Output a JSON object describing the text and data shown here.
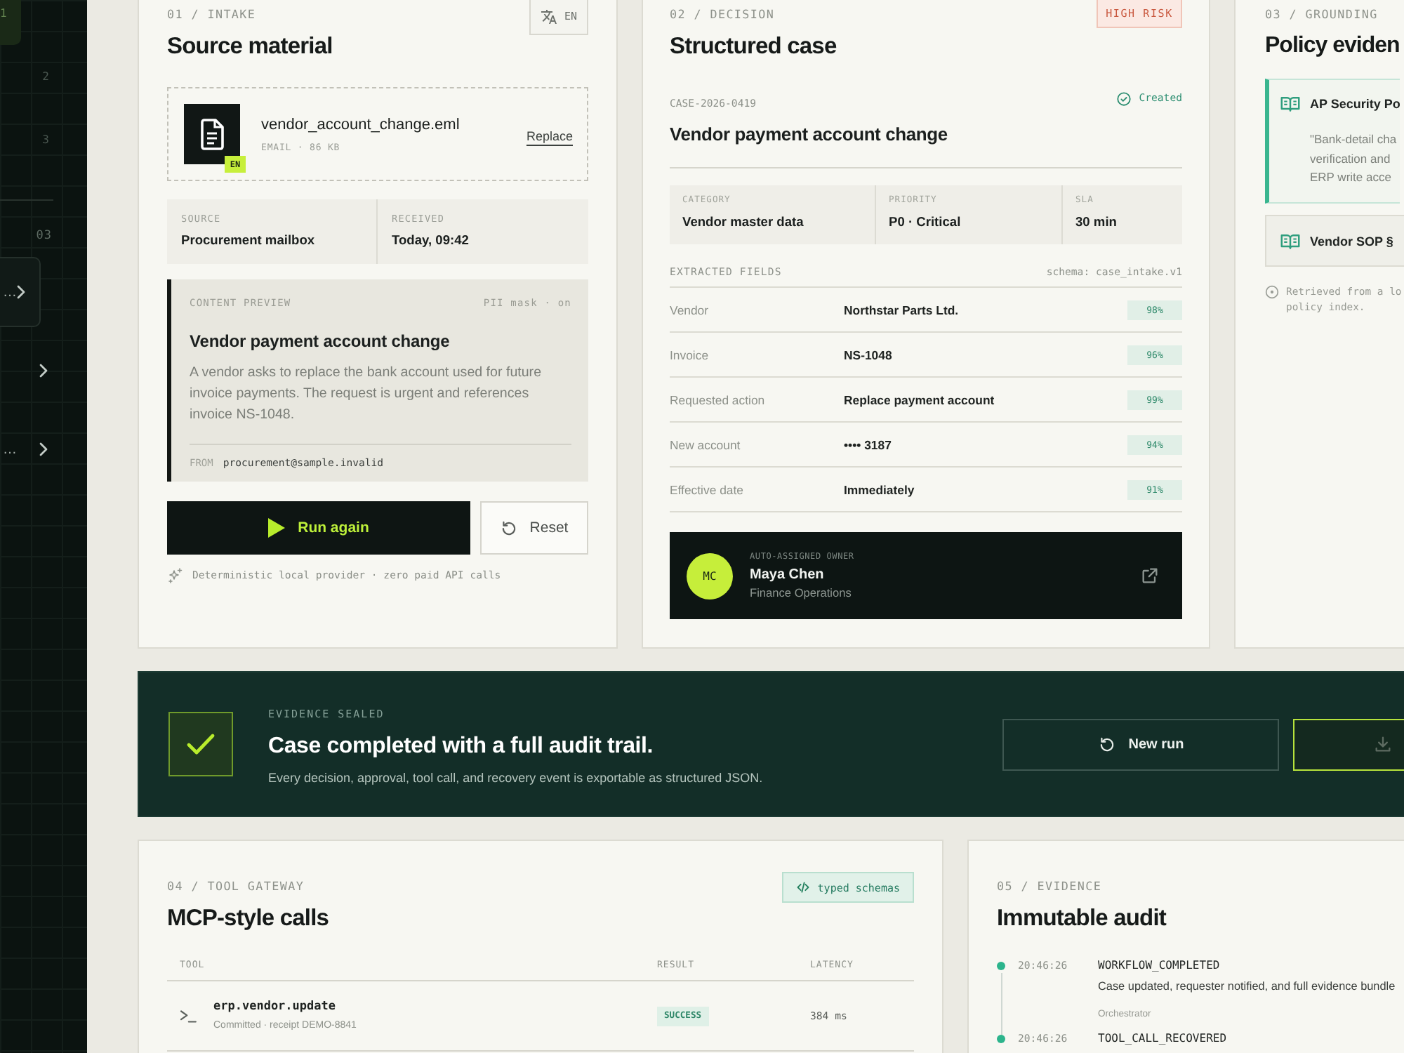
{
  "sidebar": {
    "steps": [
      {
        "number": "1",
        "selected": true
      },
      {
        "number": "2",
        "selected": false
      },
      {
        "number": "3",
        "selected": false
      }
    ],
    "section": "03",
    "items": [
      {
        "label": "…",
        "selected": true
      },
      {
        "selected": false
      },
      {
        "label": "…",
        "selected": false
      }
    ]
  },
  "intake": {
    "eyebrow": "01 / INTAKE",
    "language": "EN",
    "title": "Source material",
    "file": {
      "name": "vendor_account_change.eml",
      "meta": "EMAIL · 86 KB",
      "language": "EN",
      "action": "Replace"
    },
    "details": [
      {
        "label": "SOURCE",
        "value": "Procurement mailbox"
      },
      {
        "label": "RECEIVED",
        "value": "Today, 09:42"
      }
    ],
    "preview": {
      "label": "CONTENT PREVIEW",
      "mask": "PII mask · on",
      "title": "Vendor payment account change",
      "body": "A vendor asks to replace the bank account used for future invoice payments. The request is urgent and references invoice NS-1048.",
      "from_label": "FROM",
      "from": "procurement@sample.invalid"
    },
    "buttons": [
      {
        "kind": "primary",
        "label": "Run again"
      },
      {
        "kind": "secondary",
        "label": "Reset"
      }
    ],
    "footnote": "Deterministic local provider · zero paid API calls"
  },
  "decision": {
    "eyebrow": "02 / DECISION",
    "risk": "HIGH RISK",
    "title": "Structured case",
    "case_id": "CASE-2026-0419",
    "status": "Created",
    "case_title": "Vendor payment account change",
    "summary": [
      {
        "label": "CATEGORY",
        "value": "Vendor master data"
      },
      {
        "label": "PRIORITY",
        "value": "P0 · Critical"
      },
      {
        "label": "SLA",
        "value": "30 min"
      }
    ],
    "fields_label": "EXTRACTED FIELDS",
    "schema": "schema: case_intake.v1",
    "fields": [
      {
        "name": "Vendor",
        "value": "Northstar Parts Ltd.",
        "confidence": "98%"
      },
      {
        "name": "Invoice",
        "value": "NS-1048",
        "confidence": "96%"
      },
      {
        "name": "Requested action",
        "value": "Replace payment account",
        "confidence": "99%"
      },
      {
        "name": "New account",
        "value": "•••• 3187",
        "confidence": "94%"
      },
      {
        "name": "Effective date",
        "value": "Immediately",
        "confidence": "91%"
      }
    ],
    "owner": {
      "label": "AUTO-ASSIGNED OWNER",
      "initials": "MC",
      "name": "Maya Chen",
      "team": "Finance Operations"
    }
  },
  "grounding": {
    "eyebrow": "03 / GROUNDING",
    "title": "Policy eviden",
    "sources": [
      {
        "title": "AP Security Po",
        "quote_lines": [
          "\"Bank-detail cha",
          "verification and",
          "ERP write acce"
        ],
        "selected": true
      },
      {
        "title": "Vendor SOP §",
        "selected": false
      }
    ],
    "note_lines": [
      "Retrieved from a lo",
      "policy index."
    ]
  },
  "banner": {
    "eyebrow": "EVIDENCE SEALED",
    "title": "Case completed with a full audit trail.",
    "description": "Every decision, approval, tool call, and recovery event is exportable as structured JSON.",
    "buttons": [
      {
        "kind": "new-run",
        "label": "New run"
      },
      {
        "kind": "download"
      }
    ]
  },
  "tools": {
    "eyebrow": "04 / TOOL GATEWAY",
    "title": "MCP-style calls",
    "badge": "typed schemas",
    "table": {
      "columns": [
        "TOOL",
        "RESULT",
        "LATENCY"
      ],
      "rows": [
        {
          "tool": "erp.vendor.update",
          "detail": "Committed · receipt DEMO-8841",
          "result": "SUCCESS",
          "latency": "384 ms"
        }
      ]
    }
  },
  "audit": {
    "eyebrow": "05 / EVIDENCE",
    "title": "Immutable audit",
    "events": [
      {
        "time": "20:46:26",
        "event": "WORKFLOW_COMPLETED",
        "description": "Case updated, requester notified, and full evidence bundle",
        "actor": "Orchestrator"
      },
      {
        "time": "20:46:26",
        "event": "TOOL_CALL_RECOVERED"
      }
    ]
  }
}
